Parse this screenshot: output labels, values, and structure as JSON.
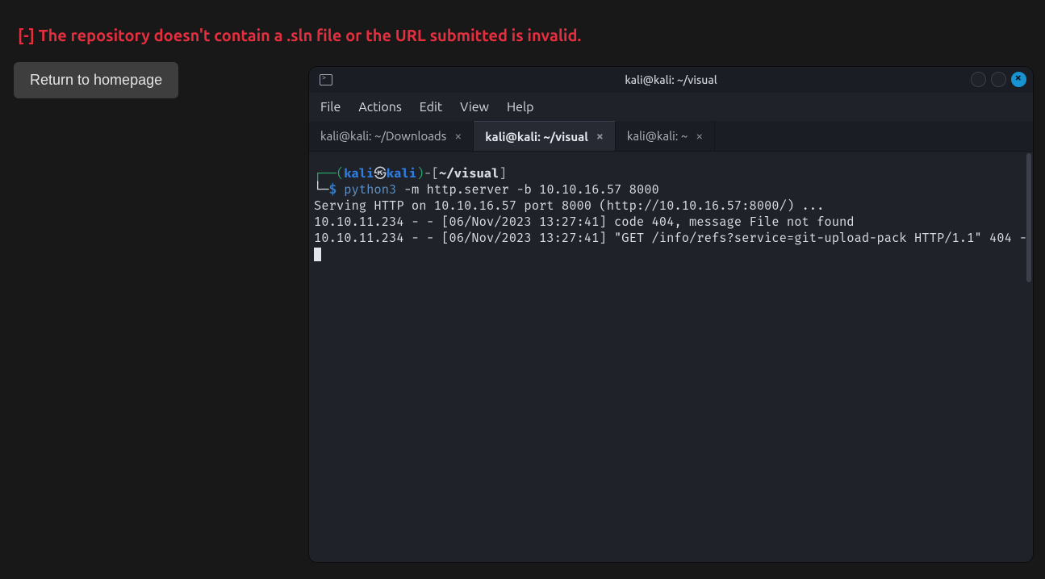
{
  "page": {
    "error": "[-] The repository doesn't contain a .sln file or the URL submitted is invalid.",
    "return_btn": "Return to homepage"
  },
  "terminal": {
    "title": "kali@kali: ~/visual",
    "menu": {
      "file": "File",
      "actions": "Actions",
      "edit": "Edit",
      "view": "View",
      "help": "Help"
    },
    "tabs": [
      {
        "label": "kali@kali: ~/Downloads",
        "active": false
      },
      {
        "label": "kali@kali: ~/visual",
        "active": true
      },
      {
        "label": "kali@kali: ~",
        "active": false
      }
    ],
    "prompt": {
      "user": "kali",
      "host": "kali",
      "path": "~/visual",
      "cmd": "python3",
      "args": "-m http.server -b 10.10.16.57 8000"
    },
    "output": "Serving HTTP on 10.10.16.57 port 8000 (http://10.10.16.57:8000/) ...\n10.10.11.234 - - [06/Nov/2023 13:27:41] code 404, message File not found\n10.10.11.234 - - [06/Nov/2023 13:27:41] \"GET /info/refs?service=git-upload-pack HTTP/1.1\" 404 -"
  }
}
